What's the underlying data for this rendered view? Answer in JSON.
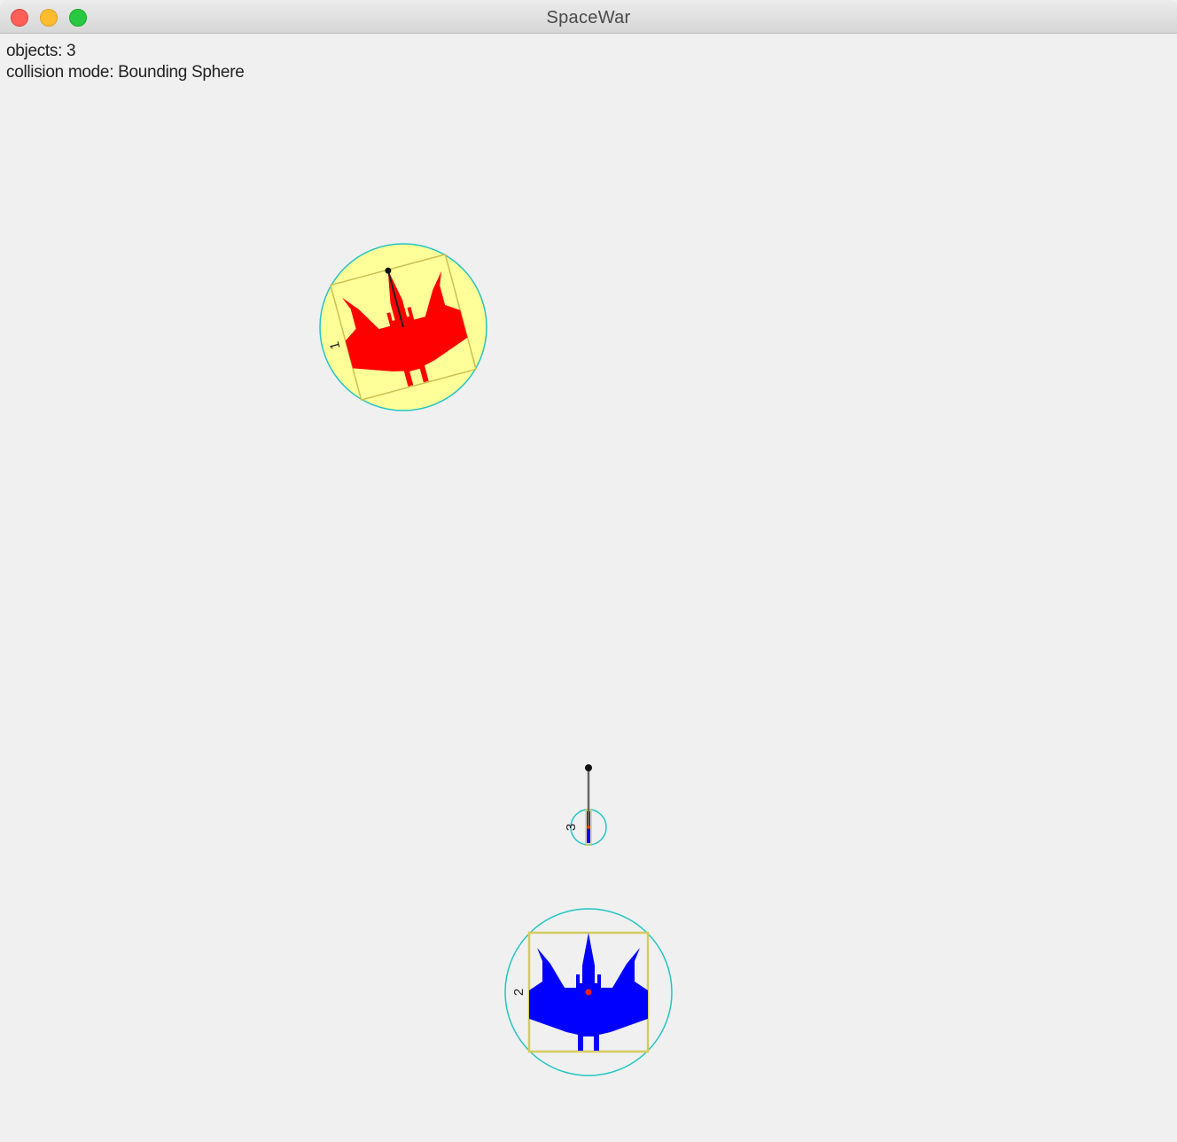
{
  "window": {
    "title": "SpaceWar"
  },
  "hud": {
    "objects_label": "objects: 3",
    "collision_label": "collision mode: Bounding Sphere"
  },
  "colors": {
    "ship1": "#ff0000",
    "ship2": "#0000ff",
    "bounding_circle": "#22c4c4",
    "bounding_box": "#d4cc60",
    "highlight_fill": "#ffff99"
  },
  "objects": [
    {
      "id_label": "1",
      "kind": "ship",
      "color": "red",
      "highlighted": true
    },
    {
      "id_label": "2",
      "kind": "ship",
      "color": "blue",
      "highlighted": false
    },
    {
      "id_label": "3",
      "kind": "projectile",
      "color": "blue",
      "highlighted": false
    }
  ]
}
